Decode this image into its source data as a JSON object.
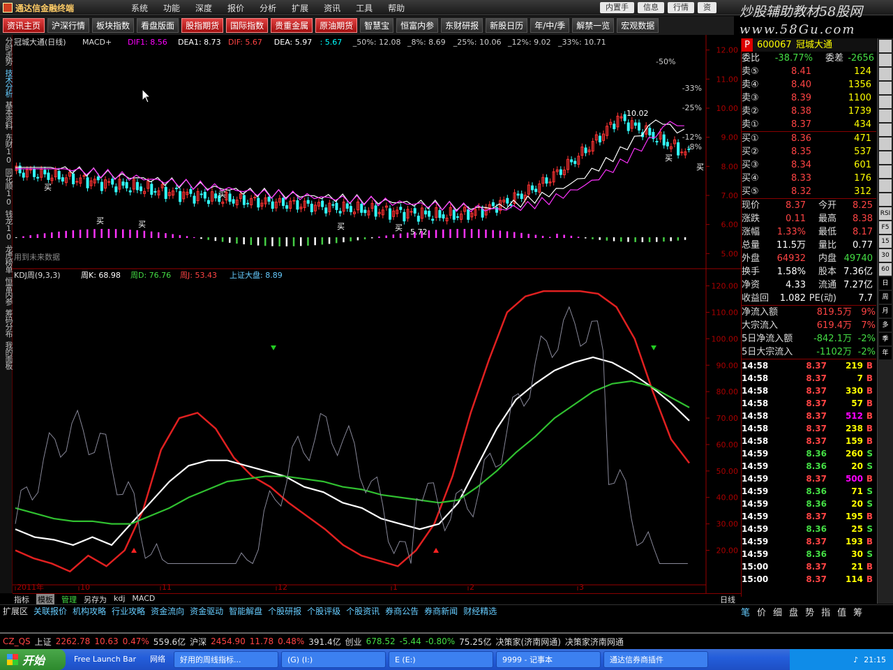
{
  "app": {
    "title": "通达信金融终端"
  },
  "menu": [
    "系统",
    "功能",
    "深度",
    "报价",
    "分析",
    "扩展",
    "资讯",
    "工具",
    "帮助"
  ],
  "window_buttons": [
    "内置手",
    "信息",
    "行情",
    "资"
  ],
  "watermark": {
    "line1": "炒股辅助教材58股网",
    "line2": "www.58Gu.com"
  },
  "toolbar": [
    {
      "label": "资讯主页",
      "style": "red"
    },
    {
      "label": "沪深行情",
      "style": "normal"
    },
    {
      "label": "板块指数",
      "style": "normal"
    },
    {
      "label": "看盘版面",
      "style": "normal"
    },
    {
      "label": "股指期货",
      "style": "red"
    },
    {
      "label": "国际指数",
      "style": "red"
    },
    {
      "label": "贵重金属",
      "style": "red"
    },
    {
      "label": "原油期货",
      "style": "red"
    },
    {
      "label": "智慧宝",
      "style": "normal"
    },
    {
      "label": "恒富内参",
      "style": "normal"
    },
    {
      "label": "东财研报",
      "style": "normal"
    },
    {
      "label": "新股日历",
      "style": "normal"
    },
    {
      "label": "年/中/季",
      "style": "normal"
    },
    {
      "label": "解禁一览",
      "style": "normal"
    },
    {
      "label": "宏观数据",
      "style": "normal"
    }
  ],
  "sidebar": [
    "分时走势",
    "技术分析",
    "基本资料",
    "东财10",
    "同花顺10",
    "钱龙10",
    "龙虎榜单",
    "恒富内参",
    "筹码分布",
    "我的面板"
  ],
  "upper_chart": {
    "header": {
      "name": "冠城大通(日线)",
      "indicator": "MACD+",
      "dif1": "DIF1: 8.56",
      "dea1": "DEA1: 8.73",
      "dif": "DIF: 5.67",
      "dea": "DEA: 5.97",
      "val": ": 5.67",
      "p50": "_50%: 12.08",
      "p8": "_8%: 8.69",
      "p25": "_25%: 10.06",
      "p12": "_12%: 9.02",
      "p33": "_33%: 10.71"
    },
    "y_labels": [
      "12.00",
      "11.00",
      "10.00",
      "9.00",
      "8.00",
      "7.00",
      "6.00",
      "5.00"
    ],
    "pct_labels": [
      "-33%",
      "-25%",
      "-12%",
      "-8%",
      "-50%"
    ],
    "annotations": {
      "high": "10.02",
      "low": "5.72",
      "buy": "买"
    },
    "note": "用到未来数据",
    "y_range": [
      4.6,
      12.4
    ]
  },
  "lower_chart": {
    "header": {
      "name": "KDJ周(9,3,3)",
      "k": "周K: 68.98",
      "d": "周D: 76.76",
      "j": "周J: 53.43",
      "idx": "上证大盘: 8.89"
    },
    "y_labels": [
      "120.00",
      "110.00",
      "100.00",
      "90.00",
      "80.00",
      "70.00",
      "60.00",
      "50.00",
      "40.00",
      "30.00",
      "20.00"
    ],
    "x_labels": [
      "2011年",
      "10",
      "11",
      "12",
      "1",
      "2",
      "3"
    ],
    "y_range": [
      8,
      122
    ]
  },
  "chart_data": {
    "type": "line",
    "title": "KDJ周(9,3,3)",
    "x": [
      0,
      1,
      2,
      3,
      4,
      5,
      6,
      7,
      8,
      9,
      10,
      11,
      12,
      13,
      14,
      15,
      16,
      17,
      18,
      19,
      20,
      21,
      22,
      23,
      24,
      25,
      26,
      27,
      28,
      29,
      30,
      31,
      32,
      33,
      34,
      35,
      36,
      37,
      38,
      39,
      40,
      41,
      42,
      43,
      44,
      45
    ],
    "series": [
      {
        "name": "周J",
        "color": "#e02020",
        "values": [
          20,
          17,
          15,
          12,
          18,
          14,
          20,
          35,
          58,
          70,
          72,
          66,
          55,
          48,
          44,
          38,
          33,
          28,
          22,
          18,
          16,
          14,
          20,
          30,
          48,
          72,
          92,
          110,
          116,
          118,
          118,
          118,
          117,
          112,
          100,
          80,
          62,
          53
        ]
      },
      {
        "name": "周K",
        "color": "#ffffff",
        "values": [
          28,
          25,
          24,
          22,
          25,
          22,
          30,
          38,
          46,
          52,
          54,
          54,
          52,
          50,
          48,
          44,
          42,
          38,
          36,
          32,
          30,
          28,
          30,
          38,
          52,
          66,
          77,
          83,
          88,
          91,
          93,
          91,
          87,
          82,
          76,
          69
        ]
      },
      {
        "name": "周D",
        "color": "#30c030",
        "values": [
          36,
          34,
          32,
          31,
          31,
          30,
          30,
          33,
          36,
          40,
          43,
          46,
          47,
          48,
          48,
          47,
          46,
          44,
          43,
          41,
          40,
          39,
          38,
          39,
          44,
          50,
          57,
          63,
          70,
          75,
          80,
          83,
          84,
          82,
          78,
          74
        ]
      }
    ],
    "ylim": [
      10,
      120
    ]
  },
  "stock": {
    "code": "600067",
    "name": "冠城大通",
    "weibi_label": "委比",
    "weibi": "-38.77%",
    "weicha_label": "委差",
    "weicha": "-2656"
  },
  "asks": [
    {
      "label": "卖⑤",
      "price": "8.41",
      "vol": "124"
    },
    {
      "label": "卖④",
      "price": "8.40",
      "vol": "1356"
    },
    {
      "label": "卖③",
      "price": "8.39",
      "vol": "1100"
    },
    {
      "label": "卖②",
      "price": "8.38",
      "vol": "1739"
    },
    {
      "label": "卖①",
      "price": "8.37",
      "vol": "434"
    }
  ],
  "bids": [
    {
      "label": "买①",
      "price": "8.36",
      "vol": "471"
    },
    {
      "label": "买②",
      "price": "8.35",
      "vol": "537"
    },
    {
      "label": "买③",
      "price": "8.34",
      "vol": "601"
    },
    {
      "label": "买④",
      "price": "8.33",
      "vol": "176"
    },
    {
      "label": "买⑤",
      "price": "8.32",
      "vol": "312"
    }
  ],
  "quote": [
    {
      "l1": "现价",
      "v1": "8.37",
      "l2": "今开",
      "v2": "8.25"
    },
    {
      "l1": "涨跌",
      "v1": "0.11",
      "l2": "最高",
      "v2": "8.38"
    },
    {
      "l1": "涨幅",
      "v1": "1.33%",
      "l2": "最低",
      "v2": "8.17"
    },
    {
      "l1": "总量",
      "v1": "11.5万",
      "l2": "量比",
      "v2": "0.77"
    },
    {
      "l1": "外盘",
      "v1": "64932",
      "l2": "内盘",
      "v2": "49740"
    },
    {
      "l1": "换手",
      "v1": "1.58%",
      "l2": "股本",
      "v2": "7.36亿"
    },
    {
      "l1": "净资",
      "v1": "4.33",
      "l2": "流通",
      "v2": "7.27亿"
    },
    {
      "l1": "收益回",
      "v1": "1.082",
      "l2": "PE(动)",
      "v2": "7.7"
    }
  ],
  "flows": [
    {
      "label": "净流入额",
      "val": "819.5万",
      "pct": "9%"
    },
    {
      "label": "大宗流入",
      "val": "619.4万",
      "pct": "7%"
    },
    {
      "label": "5日净流入额",
      "val": "-842.1万",
      "pct": "-2%"
    },
    {
      "label": "5日大宗流入",
      "val": "-1102万",
      "pct": "-2%"
    }
  ],
  "ticks": [
    {
      "t": "14:58",
      "p": "8.37",
      "q": "219",
      "d": "B"
    },
    {
      "t": "14:58",
      "p": "8.37",
      "q": "7",
      "d": "B"
    },
    {
      "t": "14:58",
      "p": "8.37",
      "q": "330",
      "d": "B"
    },
    {
      "t": "14:58",
      "p": "8.37",
      "q": "57",
      "d": "B"
    },
    {
      "t": "14:58",
      "p": "8.37",
      "q": "512",
      "d": "B"
    },
    {
      "t": "14:58",
      "p": "8.37",
      "q": "238",
      "d": "B"
    },
    {
      "t": "14:58",
      "p": "8.37",
      "q": "159",
      "d": "B"
    },
    {
      "t": "14:59",
      "p": "8.36",
      "q": "260",
      "d": "S"
    },
    {
      "t": "14:59",
      "p": "8.36",
      "q": "20",
      "d": "S"
    },
    {
      "t": "14:59",
      "p": "8.37",
      "q": "500",
      "d": "B"
    },
    {
      "t": "14:59",
      "p": "8.36",
      "q": "71",
      "d": "S"
    },
    {
      "t": "14:59",
      "p": "8.36",
      "q": "20",
      "d": "S"
    },
    {
      "t": "14:59",
      "p": "8.37",
      "q": "195",
      "d": "B"
    },
    {
      "t": "14:59",
      "p": "8.36",
      "q": "25",
      "d": "S"
    },
    {
      "t": "14:59",
      "p": "8.37",
      "q": "193",
      "d": "B"
    },
    {
      "t": "14:59",
      "p": "8.36",
      "q": "30",
      "d": "S"
    },
    {
      "t": "15:00",
      "p": "8.37",
      "q": "21",
      "d": "B"
    },
    {
      "t": "15:00",
      "p": "8.37",
      "q": "114",
      "d": "B"
    }
  ],
  "right_tools": [
    "RSI",
    "F5",
    "15",
    "30",
    "60",
    "日",
    "周",
    "月",
    "多",
    "季",
    "年"
  ],
  "tabbar": {
    "items": [
      "指标",
      "模板",
      "管理",
      "另存为",
      "kdj",
      "MACD"
    ],
    "sel": "模板",
    "green": "管理",
    "right": "日线"
  },
  "bottomnav": [
    "扩展区",
    "关联报价",
    "机构攻略",
    "行业攻略",
    "资金流向",
    "资金驱动",
    "智能解盘",
    "个股研报",
    "个股评级",
    "个股资讯",
    "券商公告",
    "券商新闻",
    "财经精选"
  ],
  "rightnav": [
    "笔",
    "价",
    "细",
    "盘",
    "势",
    "指",
    "值",
    "筹"
  ],
  "ticker": [
    {
      "text": "CZ_QS",
      "color": "#f44"
    },
    {
      "text": "上证",
      "color": "#ddd"
    },
    {
      "text": "2262.78",
      "color": "#f44"
    },
    {
      "text": "10.63",
      "color": "#f44"
    },
    {
      "text": "0.47%",
      "color": "#f44"
    },
    {
      "text": "559.6亿",
      "color": "#ddd"
    },
    {
      "text": "沪深",
      "color": "#ddd"
    },
    {
      "text": "2454.90",
      "color": "#f44"
    },
    {
      "text": "11.78",
      "color": "#f44"
    },
    {
      "text": "0.48%",
      "color": "#f44"
    },
    {
      "text": "391.4亿",
      "color": "#ddd"
    },
    {
      "text": "创业",
      "color": "#ddd"
    },
    {
      "text": "678.52",
      "color": "#4d4"
    },
    {
      "text": "-5.44",
      "color": "#4d4"
    },
    {
      "text": "-0.80%",
      "color": "#4d4"
    },
    {
      "text": "75.25亿",
      "color": "#ddd"
    },
    {
      "text": "决策家(济南网通)",
      "color": "#ddd"
    },
    {
      "text": "决策家济南网通",
      "color": "#ddd"
    }
  ],
  "taskbar": {
    "start": "开始",
    "items": [
      "Free Launch Bar",
      "网络",
      "好用的周线指标...",
      "(G) (I:)",
      "E (E:)",
      "9999 - 记事本",
      "通达信券商插件"
    ],
    "clock": "21:15"
  }
}
